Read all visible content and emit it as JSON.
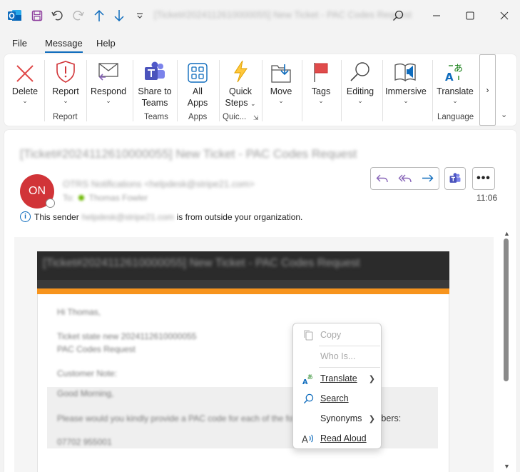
{
  "window": {
    "title": "[Ticket#2024112610000055] New Ticket - PAC Codes Request",
    "app_icon": "outlook-icon"
  },
  "menus": [
    {
      "label": "File"
    },
    {
      "label": "Message"
    },
    {
      "label": "Help"
    }
  ],
  "ribbon": {
    "buttons": {
      "delete": "Delete",
      "report": "Report",
      "respond": "Respond",
      "share_teams_1": "Share to",
      "share_teams_2": "Teams",
      "all_apps_1": "All",
      "all_apps_2": "Apps",
      "quick_steps_1": "Quick",
      "quick_steps_2": "Steps",
      "move": "Move",
      "tags": "Tags",
      "editing": "Editing",
      "immersive": "Immersive",
      "translate": "Translate"
    },
    "groups": {
      "report": "Report",
      "teams": "Teams",
      "apps": "Apps",
      "quick": "Quic...",
      "language": "Language"
    }
  },
  "message": {
    "subject": "[Ticket#2024112610000055] New Ticket - PAC Codes Request",
    "avatar_initials": "ON",
    "from": "OTRS Notifications <helpdesk@stripe21.com>",
    "to_prefix": "To:",
    "to": "Thomas Fowler",
    "time": "11:06",
    "notice_prefix": "This sender",
    "notice_sender": "helpdesk@stripe21.com",
    "notice_suffix": "is from outside your organization.",
    "banner": "[Ticket#2024112610000055] New Ticket - PAC Codes Request",
    "greeting": "Hi Thomas,",
    "line1": "Ticket state new 2024112610000055",
    "line2": "PAC Codes Request",
    "customer_note": "Customer Note:",
    "quote1": "Good Morning,",
    "quote2_blur": "Please would you kindly provide a PAC code for each of the following",
    "quote2_visible": "mbers:",
    "quote3": "07702 955001"
  },
  "context_menu": {
    "copy": "Copy",
    "who_is": "Who Is...",
    "translate": "Translate",
    "search": "Search",
    "synonyms": "Synonyms",
    "read_aloud": "Read Aloud"
  },
  "colors": {
    "accent": "#0f6cbd",
    "avatar": "#d13438",
    "banner": "#2b2b2b",
    "stripe": "#f7941d",
    "reply_purple": "#8764b8"
  }
}
